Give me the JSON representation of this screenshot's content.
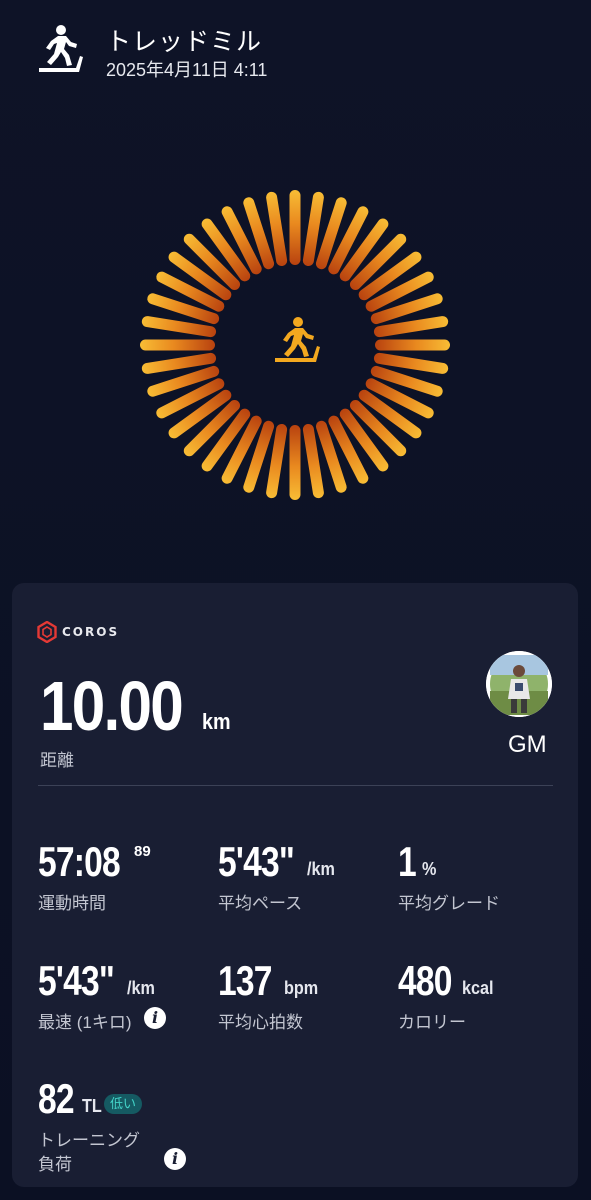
{
  "header": {
    "icon": "treadmill-icon",
    "title": "トレッドミル",
    "datetime": "2025年4月11日 4:11"
  },
  "hero": {
    "icon": "treadmill-icon",
    "ring_colors": {
      "outer": "#f7b733",
      "inner": "#c2410c"
    }
  },
  "card": {
    "brand": {
      "logo": "coros-logo",
      "name": "COROS",
      "color": "#e53935"
    },
    "distance": {
      "value": "10.00",
      "unit": "km",
      "label": "距離"
    },
    "user": {
      "avatar": "avatar",
      "name": "GM"
    },
    "stats": {
      "moving_time": {
        "value": "57:08",
        "sup": "89",
        "label": "運動時間"
      },
      "avg_pace": {
        "value": "5'43\"",
        "unit": "/km",
        "label": "平均ペース"
      },
      "avg_grade": {
        "value": "1",
        "unit": "%",
        "label": "平均グレード"
      },
      "best_1k": {
        "value": "5'43\"",
        "unit": "/km",
        "label": "最速 (1キロ)",
        "info": "i"
      },
      "avg_hr": {
        "value": "137",
        "unit": "bpm",
        "label": "平均心拍数"
      },
      "calories": {
        "value": "480",
        "unit": "kcal",
        "label": "カロリー"
      },
      "training_load": {
        "value": "82",
        "unit": "TL",
        "badge": "低い",
        "label_line1": "トレーニング",
        "label_line2": "負荷",
        "info": "i"
      }
    }
  }
}
